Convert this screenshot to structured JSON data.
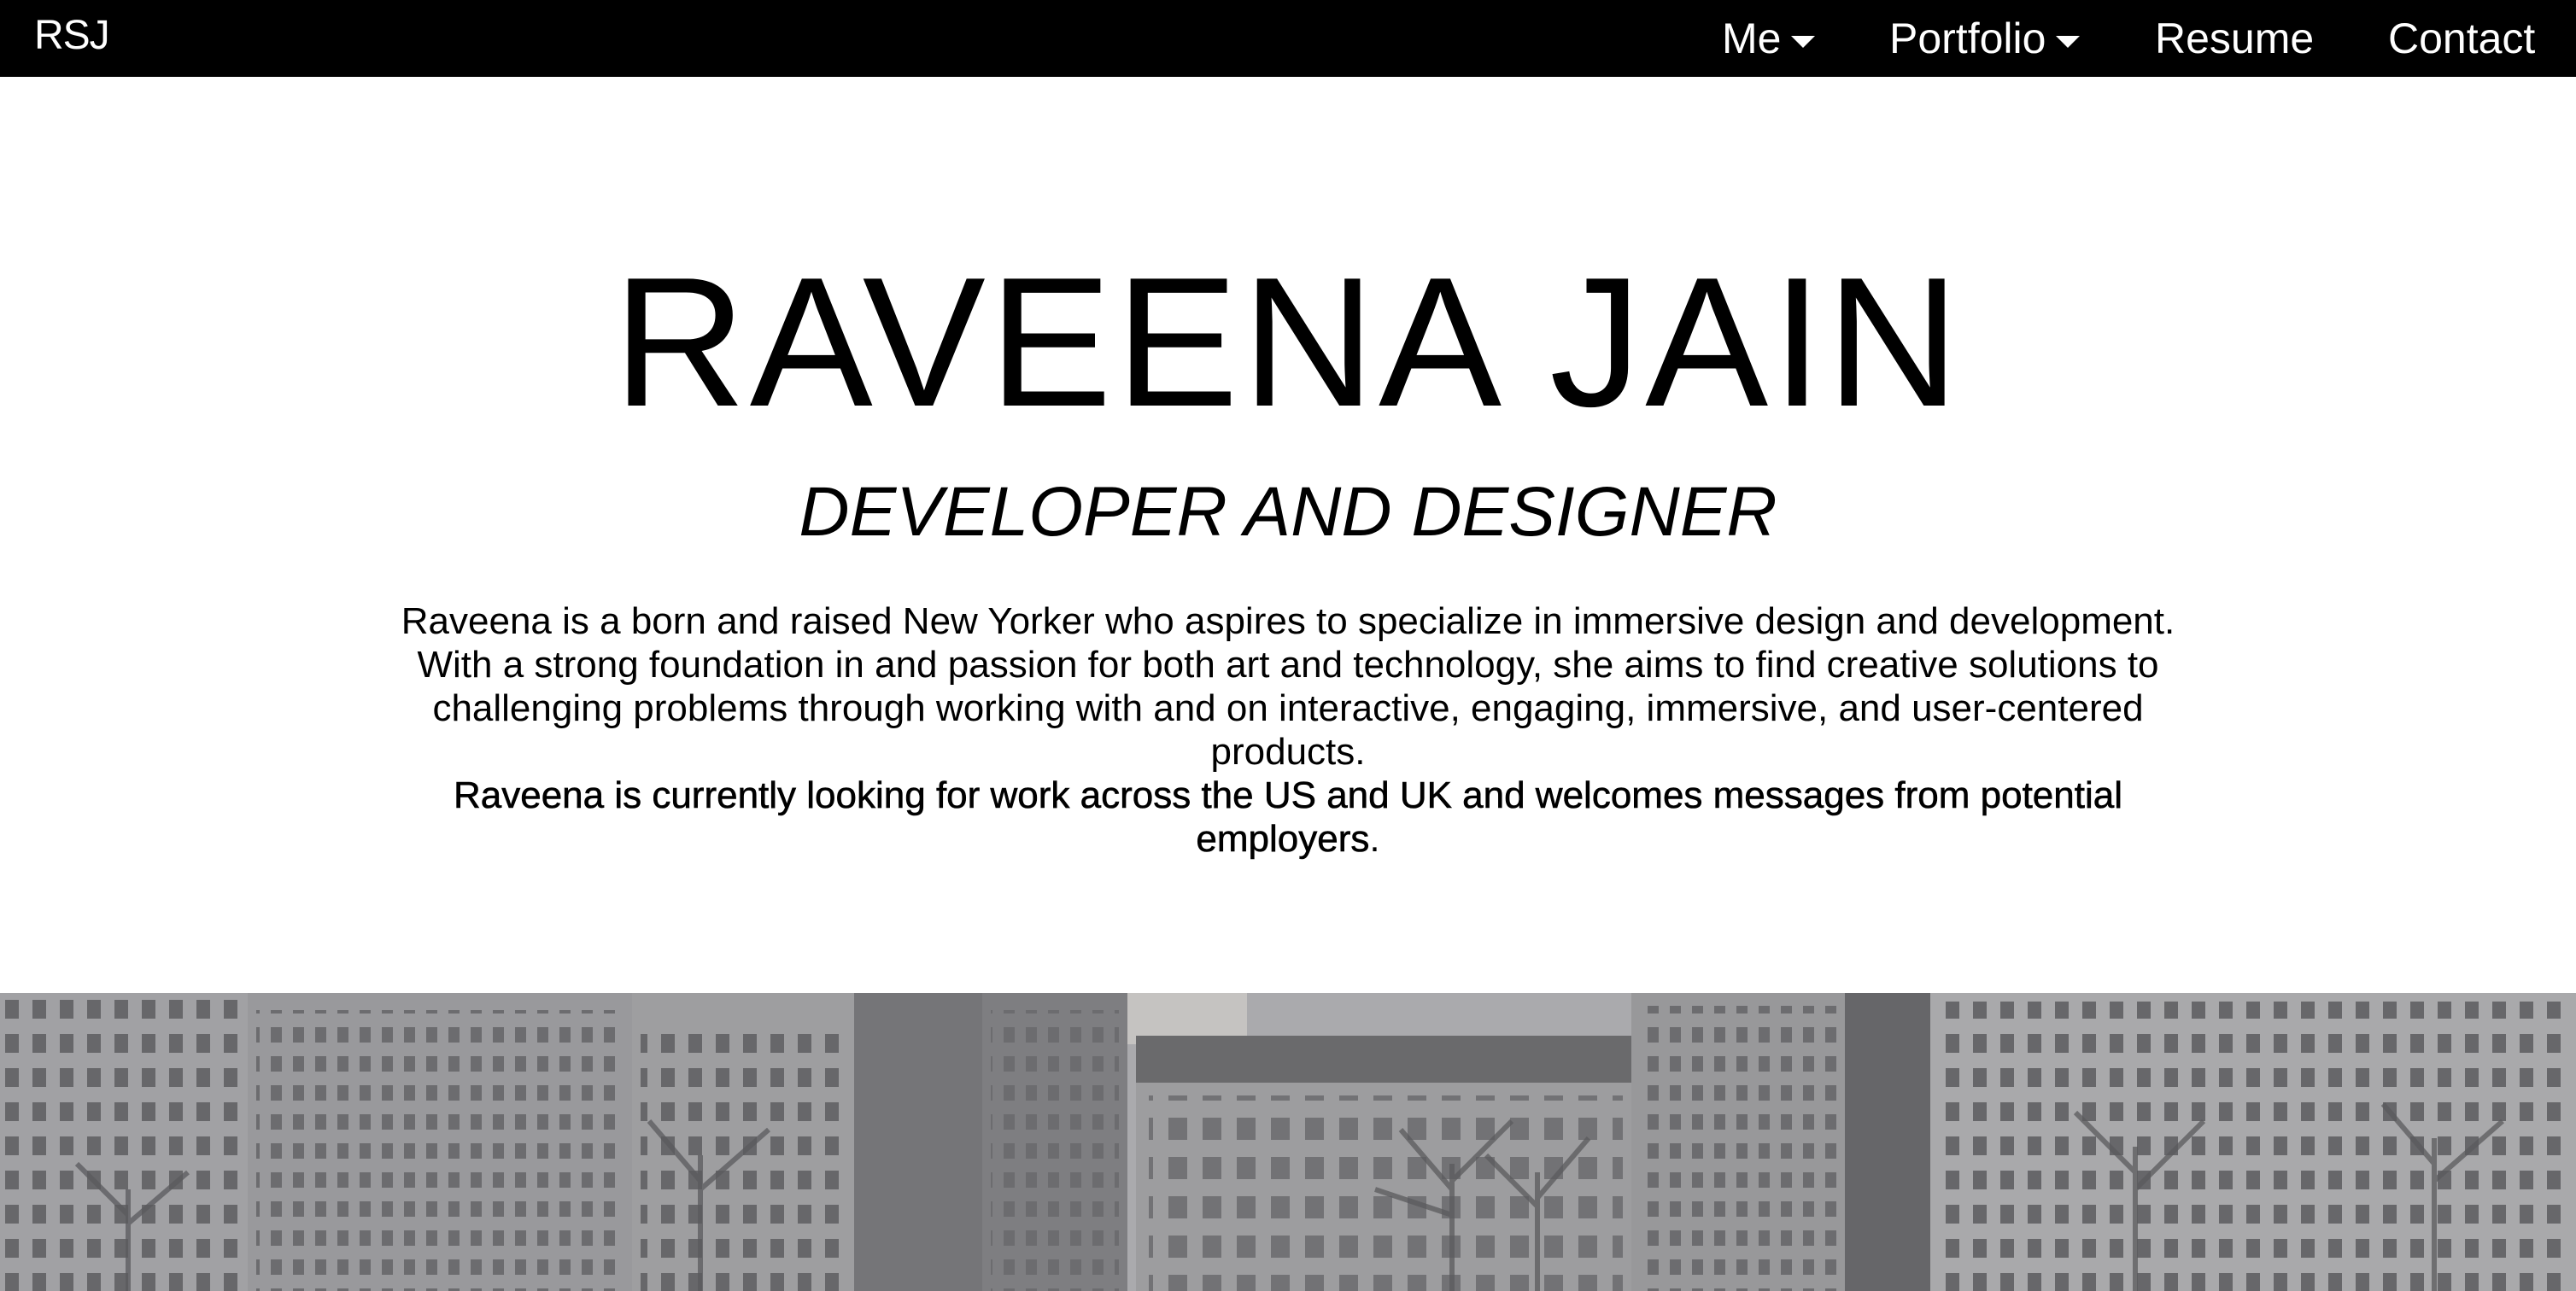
{
  "nav": {
    "brand": "RSJ",
    "items": [
      {
        "label": "Me",
        "has_dropdown": true
      },
      {
        "label": "Portfolio",
        "has_dropdown": true
      },
      {
        "label": "Resume",
        "has_dropdown": false
      },
      {
        "label": "Contact",
        "has_dropdown": false
      }
    ]
  },
  "hero": {
    "name": "RAVEENA JAIN",
    "subtitle": "DEVELOPER AND DESIGNER",
    "bio_intro": "Raveena is a born and raised New Yorker who aspires to specialize in immersive design and development. With a strong foundation in and passion for both art and technology, she aims to find creative solutions to challenging problems through working with and on interactive, engaging, immersive, and user-centered products.",
    "bio_highlight": "Raveena is currently looking for work across the US and UK and welcomes messages from potential employers",
    "bio_end": "."
  },
  "colors": {
    "navbar_bg": "#000000",
    "nav_text": "#ffffff",
    "page_bg": "#ffffff",
    "text": "#000000"
  },
  "icons": {
    "dropdown": "caret-down-icon"
  }
}
